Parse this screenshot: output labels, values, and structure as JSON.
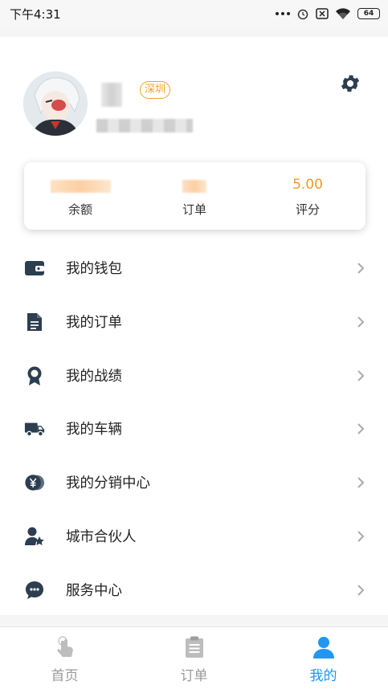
{
  "status_bar": {
    "time": "下午4:31",
    "battery": "64",
    "icons": [
      "more-dots-icon",
      "alarm-icon",
      "sim-off-icon",
      "wifi-icon",
      "battery-icon"
    ]
  },
  "profile": {
    "city_tag": "深圳",
    "settings_icon": "gear-icon"
  },
  "stats": [
    {
      "value": "",
      "label": "余额"
    },
    {
      "value": "",
      "label": "订单"
    },
    {
      "value": "5.00",
      "label": "评分"
    }
  ],
  "menu": [
    {
      "label": "我的钱包",
      "icon": "wallet-icon"
    },
    {
      "label": "我的订单",
      "icon": "document-icon"
    },
    {
      "label": "我的战绩",
      "icon": "award-ribbon-icon"
    },
    {
      "label": "我的车辆",
      "icon": "truck-icon"
    },
    {
      "label": "我的分销中心",
      "icon": "yuan-coin-icon"
    },
    {
      "label": "城市合伙人",
      "icon": "user-star-icon"
    },
    {
      "label": "服务中心",
      "icon": "service-chat-icon"
    }
  ],
  "tabbar": [
    {
      "label": "首页",
      "icon": "tap-hand-icon",
      "active": false
    },
    {
      "label": "订单",
      "icon": "clipboard-icon",
      "active": false
    },
    {
      "label": "我的",
      "icon": "user-icon",
      "active": true
    }
  ],
  "colors": {
    "accent": "#2196f3",
    "orange": "#f09a28",
    "icon_dark": "#2c3e50",
    "inactive": "#999999"
  }
}
